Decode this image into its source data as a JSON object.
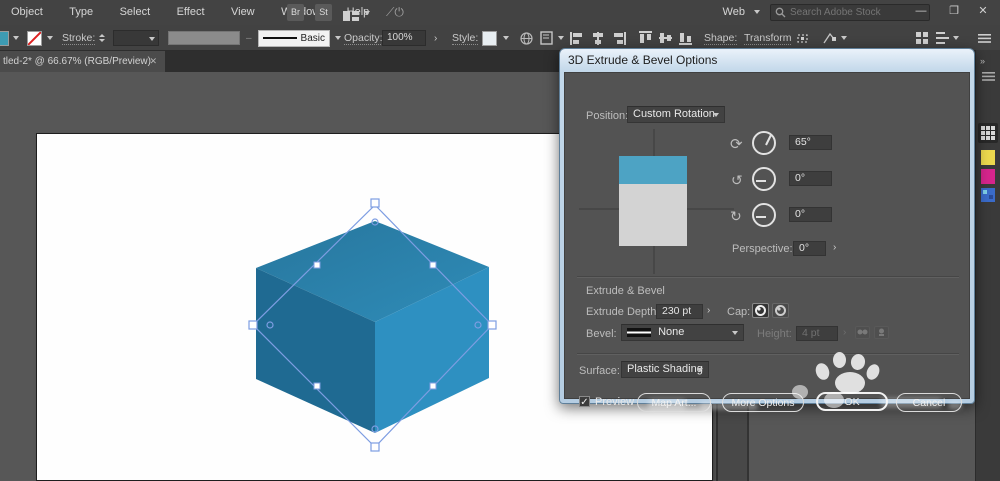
{
  "colors": {
    "cube_top_a": "#27769d",
    "cube_top_b": "#2f8cb8",
    "cube_right": "#2e90c1",
    "cube_left": "#1f6a92",
    "selection": "#7d9de2",
    "preview_band": "#4da3c4",
    "preview_body": "#d3d3d3",
    "accent": "#3c8ae0"
  },
  "menubar": {
    "items": [
      "Object",
      "Type",
      "Select",
      "Effect",
      "View",
      "Window",
      "Help"
    ],
    "bridge_button": "Br",
    "stock_button": "St",
    "workspace_label": "Web",
    "search_placeholder": "Search Adobe Stock",
    "minimize": "—",
    "restore": "❐",
    "close": "✕"
  },
  "control_bar": {
    "stroke_label": "Stroke:",
    "brush_label": "Basic",
    "opacity_label": "Opacity:",
    "opacity_value": "100%",
    "style_label": "Style:",
    "shape_label": "Shape:",
    "transform_label": "Transform"
  },
  "document_tab": {
    "title": "tled-2* @ 66.67% (RGB/Preview)",
    "close": "✕"
  },
  "dialog": {
    "title": "3D Extrude & Bevel Options",
    "position_label": "Position:",
    "position_value": "Custom Rotation",
    "rotate_x_value": "65°",
    "rotate_y_value": "0°",
    "rotate_z_value": "0°",
    "perspective_label": "Perspective:",
    "perspective_value": "0°",
    "section_label": "Extrude & Bevel",
    "extrude_depth_label": "Extrude Depth:",
    "extrude_depth_value": "230 pt",
    "cap_label": "Cap:",
    "bevel_label": "Bevel:",
    "bevel_value": "None",
    "height_label": "Height:",
    "height_value": "4 pt",
    "surface_label": "Surface:",
    "surface_value": "Plastic Shading",
    "preview_label": "Preview",
    "map_art_button": "Map Art...",
    "more_options_button": "More Options",
    "ok_button": "OK",
    "cancel_button": "Cancel"
  }
}
